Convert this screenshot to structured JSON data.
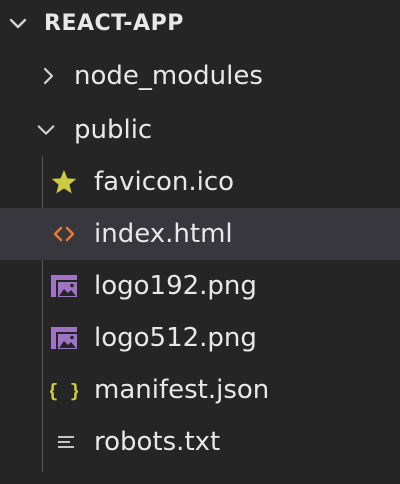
{
  "explorer": {
    "root": {
      "label": "REACT-APP",
      "expanded": true
    },
    "items": [
      {
        "label": "node_modules",
        "type": "folder",
        "expanded": false,
        "icon": "chevron-right-icon"
      },
      {
        "label": "public",
        "type": "folder",
        "expanded": true,
        "icon": "chevron-down-icon"
      },
      {
        "label": "favicon.ico",
        "type": "file",
        "icon": "star-icon"
      },
      {
        "label": "index.html",
        "type": "file",
        "icon": "html-code-icon",
        "selected": true
      },
      {
        "label": "logo192.png",
        "type": "file",
        "icon": "image-icon"
      },
      {
        "label": "logo512.png",
        "type": "file",
        "icon": "image-icon"
      },
      {
        "label": "manifest.json",
        "type": "file",
        "icon": "json-braces-icon"
      },
      {
        "label": "robots.txt",
        "type": "file",
        "icon": "text-lines-icon"
      }
    ]
  },
  "colors": {
    "background": "#252526",
    "selection": "#37373d",
    "text": "#e8e8e8",
    "star": "#cbcb41",
    "html_icon": "#e37933",
    "image_icon": "#a074c4",
    "json_icon": "#cbcb41",
    "text_icon": "#c5c5c5"
  }
}
